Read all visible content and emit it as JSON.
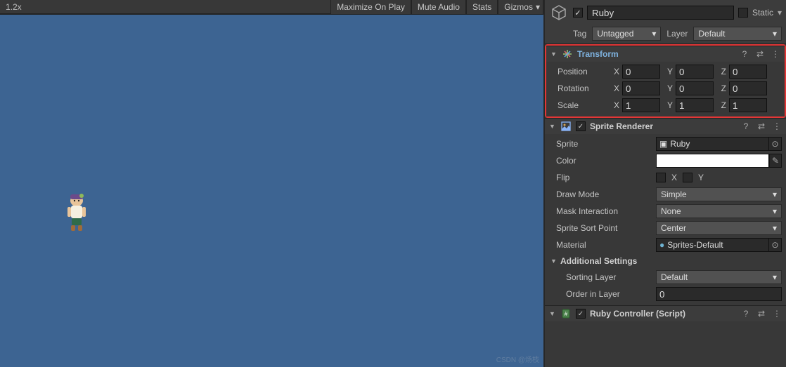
{
  "toolbar": {
    "zoom": "1.2x",
    "maximize": "Maximize On Play",
    "mute": "Mute Audio",
    "stats": "Stats",
    "gizmos": "Gizmos"
  },
  "header": {
    "name": "Ruby",
    "static_label": "Static",
    "tag_label": "Tag",
    "tag_value": "Untagged",
    "layer_label": "Layer",
    "layer_value": "Default"
  },
  "transform": {
    "title": "Transform",
    "position": {
      "label": "Position",
      "x": "0",
      "y": "0",
      "z": "0"
    },
    "rotation": {
      "label": "Rotation",
      "x": "0",
      "y": "0",
      "z": "0"
    },
    "scale": {
      "label": "Scale",
      "x": "1",
      "y": "1",
      "z": "1"
    }
  },
  "sprite_renderer": {
    "title": "Sprite Renderer",
    "sprite": {
      "label": "Sprite",
      "value": "Ruby"
    },
    "color": {
      "label": "Color",
      "value": "#ffffff"
    },
    "flip": {
      "label": "Flip",
      "x_label": "X",
      "y_label": "Y"
    },
    "draw_mode": {
      "label": "Draw Mode",
      "value": "Simple"
    },
    "mask_interaction": {
      "label": "Mask Interaction",
      "value": "None"
    },
    "sprite_sort_point": {
      "label": "Sprite Sort Point",
      "value": "Center"
    },
    "material": {
      "label": "Material",
      "value": "Sprites-Default"
    },
    "additional": {
      "title": "Additional Settings",
      "sorting_layer": {
        "label": "Sorting Layer",
        "value": "Default"
      },
      "order_in_layer": {
        "label": "Order in Layer",
        "value": "0"
      }
    }
  },
  "ruby_controller": {
    "title": "Ruby Controller (Script)"
  },
  "watermark": "CSDN @炀枝"
}
